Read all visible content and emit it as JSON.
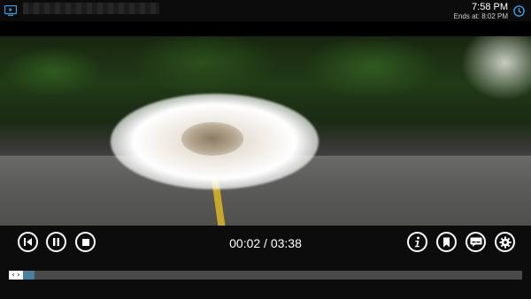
{
  "header": {
    "clock_time": "7:58 PM",
    "ends_at": "Ends at: 8:02 PM",
    "app_icon": "tv-icon",
    "clock_icon": "clock-icon"
  },
  "player": {
    "time_display": "00:02 / 03:38",
    "progress_fraction": 0.026,
    "handle_glyph": "‹ ›",
    "left_buttons": [
      "skip-previous-icon",
      "pause-icon",
      "stop-icon"
    ],
    "right_buttons": [
      "info-icon",
      "bookmark-icon",
      "subtitles-icon",
      "settings-gear-icon"
    ]
  },
  "colors": {
    "accent": "#4b7f9e",
    "clock_icon": "#3aa0e8",
    "app_icon": "#3aa0e8"
  }
}
